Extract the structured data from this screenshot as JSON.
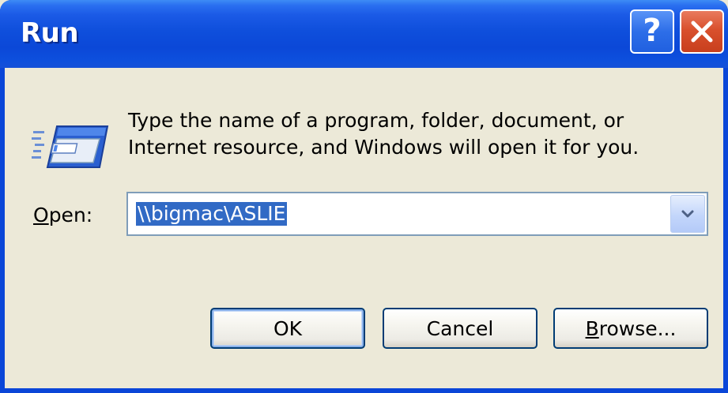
{
  "window": {
    "title": "Run",
    "help_icon": "help-question-icon",
    "close_icon": "close-x-icon"
  },
  "dialog": {
    "description_line1": "Type the name of a program, folder, document, or",
    "description_line2": "Internet resource, and Windows will open it for you.",
    "open_label_mnemonic": "O",
    "open_label_rest": "pen:",
    "open_value": "\\\\bigmac\\ASLIE",
    "run_icon": "run-window-icon"
  },
  "buttons": {
    "ok_label": "OK",
    "cancel_label": "Cancel",
    "browse_mnemonic": "B",
    "browse_rest": "rowse..."
  },
  "colors": {
    "titlebar": "#0b48d8",
    "client": "#ece9d8",
    "selection": "#316ac5",
    "close_button": "#d9502d"
  }
}
